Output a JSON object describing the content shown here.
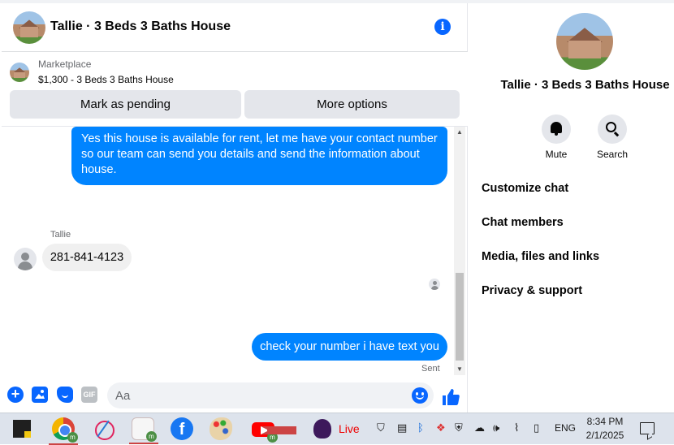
{
  "chat": {
    "title": "Tallie · 3 Beds 3 Baths House",
    "info_icon": "info-icon",
    "marketplace": {
      "label": "Marketplace",
      "listing": "$1,300 - 3 Beds 3 Baths House",
      "mark_pending": "Mark as pending",
      "more_options": "More options"
    },
    "messages": {
      "outgoing_1": "Yes this house is  available for rent, let me have your contact number so our team can send you details and send the information about house.",
      "sender_name": "Tallie",
      "incoming_1": "281-841-4123",
      "outgoing_2": "check your number i have text you",
      "status": "Sent"
    },
    "composer": {
      "placeholder": "Aa",
      "icons": [
        "plus-icon",
        "photo-icon",
        "sticker-icon",
        "gif-icon",
        "emoji-icon",
        "like-icon"
      ],
      "gif_label": "GIF"
    }
  },
  "info_panel": {
    "title": "Tallie · 3 Beds 3 Baths House",
    "actions": [
      {
        "label": "Mute",
        "icon": "bell-icon"
      },
      {
        "label": "Search",
        "icon": "search-icon"
      }
    ],
    "menu": [
      "Customize chat",
      "Chat members",
      "Media, files and links",
      "Privacy & support"
    ]
  },
  "taskbar": {
    "live_label": "Live",
    "language": "ENG",
    "time": "8:34 PM",
    "date": "2/1/2025",
    "badge": "m",
    "facebook_letter": "f"
  },
  "colors": {
    "accent": "#0866ff",
    "outgoing_bubble": "#0084ff",
    "incoming_bubble": "#f0f0f0"
  }
}
